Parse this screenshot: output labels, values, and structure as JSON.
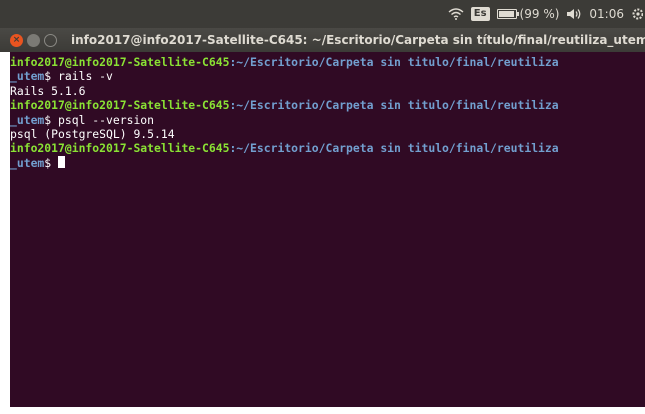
{
  "panel": {
    "keyboard_layout": "Es",
    "battery": "(99 %)",
    "battery_level_percent": 99,
    "clock": "01:06"
  },
  "window": {
    "title": "info2017@info2017-Satellite-C645: ~/Escritorio/Carpeta sin título/final/reutiliza_utem"
  },
  "terminal": {
    "prompt_user": "info2017@info2017-Satellite-C645",
    "prompt_path": ":~/Escritorio/Carpeta sin titulo/final/reutiliza",
    "prompt_path_wrap": "_utem",
    "prompt_symbol": "$ ",
    "commands": [
      {
        "command": "rails -v",
        "output": "Rails 5.1.6"
      },
      {
        "command": "psql --version",
        "output": "psql (PostgreSQL) 9.5.14"
      }
    ]
  },
  "colors": {
    "terminal_background": "#300a24",
    "prompt_user": "#8ae234",
    "prompt_path": "#729fcf",
    "panel_background": "#3c3b37",
    "close_button": "#e95420"
  }
}
